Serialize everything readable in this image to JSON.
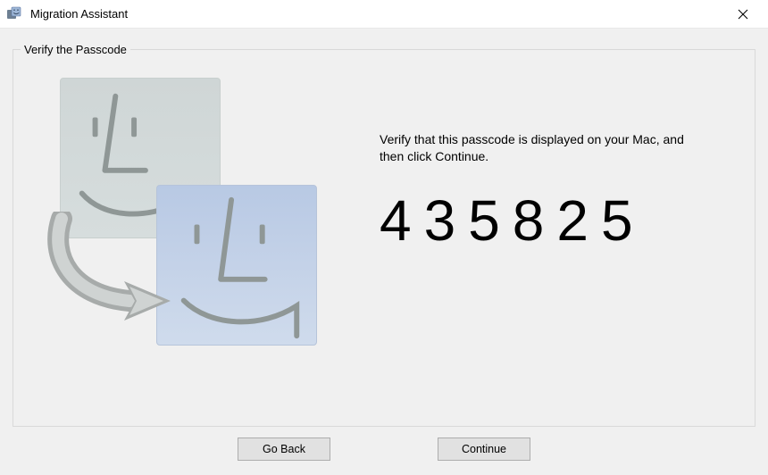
{
  "window": {
    "title": "Migration Assistant"
  },
  "group": {
    "legend": "Verify the Passcode"
  },
  "content": {
    "instruction": "Verify that this passcode is displayed on your Mac, and then click Continue.",
    "passcode": "435825"
  },
  "buttons": {
    "back": "Go Back",
    "continue": "Continue"
  },
  "icons": {
    "app": "migration-assistant-icon",
    "close": "close-icon"
  }
}
